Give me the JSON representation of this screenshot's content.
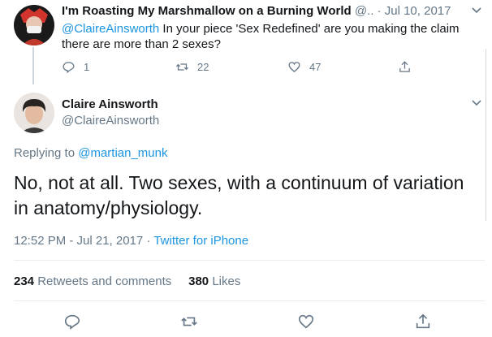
{
  "reply_tweet": {
    "display_name": "I'm Roasting My Marshmallow on a Burning World",
    "handle_trunc": "@..",
    "separator": "·",
    "date": "Jul 10, 2017",
    "mention": "@ClaireAinsworth",
    "text_line1": " In your piece 'Sex Redefined' are you making the claim",
    "text_line2": "there are more than 2 sexes?",
    "reply_count": "1",
    "retweet_count": "22",
    "like_count": "47"
  },
  "main_tweet": {
    "display_name": "Claire Ainsworth",
    "handle": "@ClaireAinsworth",
    "replying_to_label": "Replying to ",
    "replying_to_handle": "@martian_munk",
    "text": "No, not at all. Two sexes, with a continuum of variation in anatomy/physiology.",
    "time": "12:52 PM - Jul 21, 2017",
    "separator": "·",
    "source": "Twitter for iPhone",
    "retweets_count": "234",
    "retweets_label": "Retweets and comments",
    "likes_count": "380",
    "likes_label": "Likes"
  },
  "colors": {
    "link": "#1b95e0",
    "secondary_text": "#657786",
    "primary_text": "#14171a"
  },
  "icons": [
    "reply-icon",
    "retweet-icon",
    "like-icon",
    "share-icon",
    "chevron-down-icon"
  ]
}
